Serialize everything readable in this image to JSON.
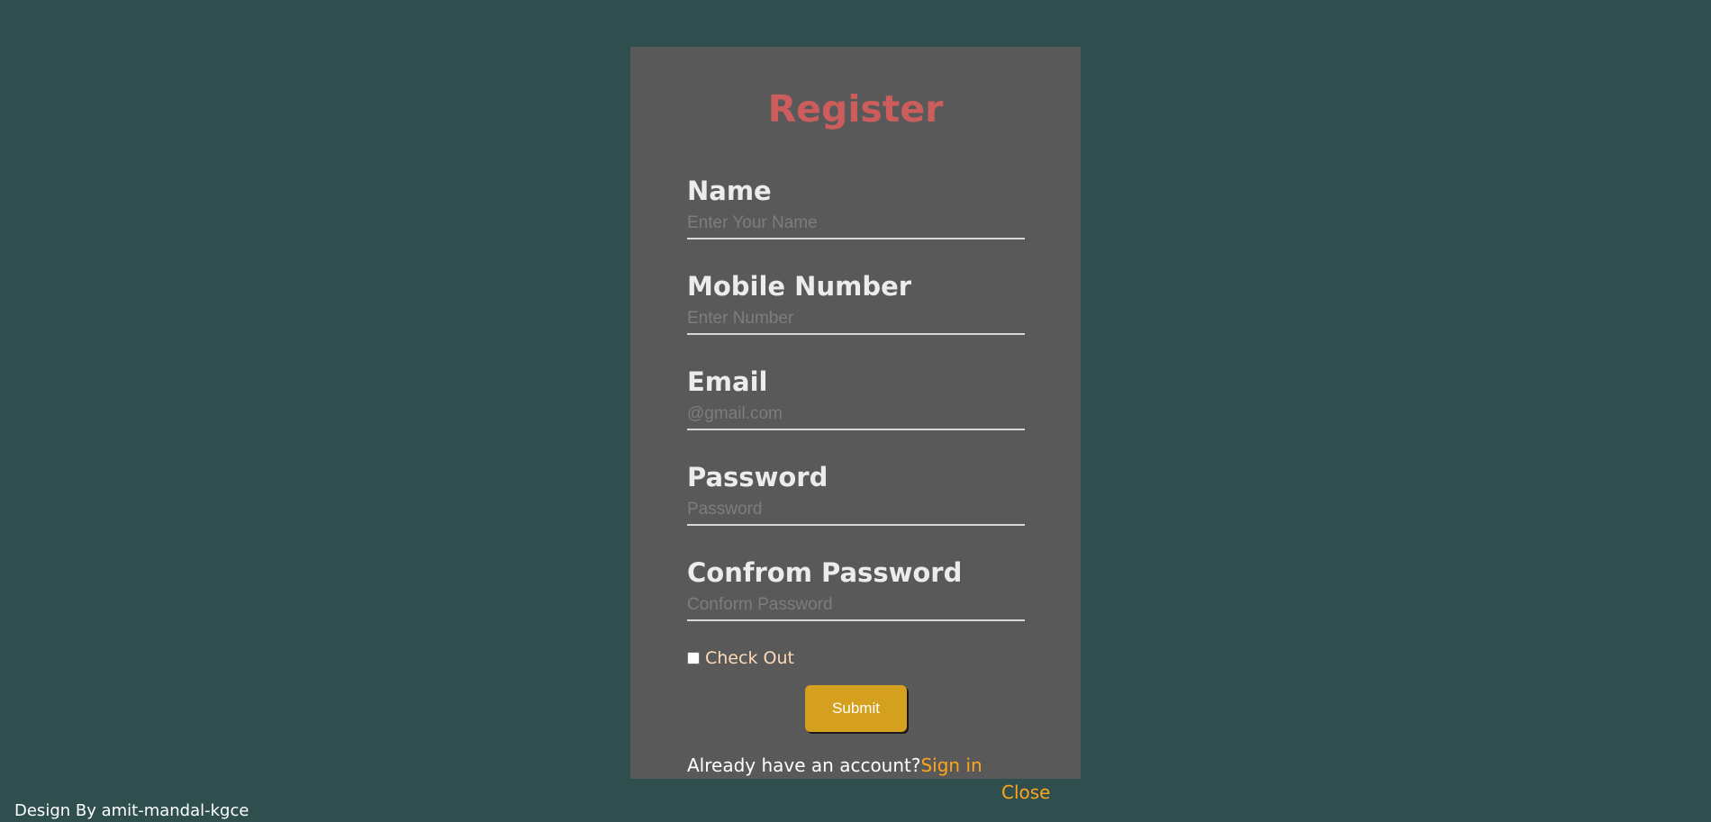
{
  "form": {
    "title": "Register",
    "fields": [
      {
        "label": "Name",
        "placeholder": "Enter Your Name",
        "type": "text"
      },
      {
        "label": "Mobile Number",
        "placeholder": "Enter Number",
        "type": "tel"
      },
      {
        "label": "Email",
        "placeholder": "@gmail.com",
        "type": "email"
      },
      {
        "label": "Password",
        "placeholder": "Password",
        "type": "password"
      },
      {
        "label": "Confrom Password",
        "placeholder": "Conform Password",
        "type": "password"
      }
    ],
    "checkbox": {
      "label": "Check Out",
      "checked": false
    },
    "submit_label": "Submit",
    "account_prompt": "Already have an account?",
    "signin_label": "Sign in"
  },
  "close_label": "Close",
  "credit": "Design By amit-mandal-kgce",
  "colors": {
    "background": "#2f4f4f",
    "card": "#595959",
    "title": "#cd5c5c",
    "label": "#ececec",
    "checkbox_label": "#ffdab9",
    "submit": "#d4a01e",
    "link": "#ffa51a"
  }
}
